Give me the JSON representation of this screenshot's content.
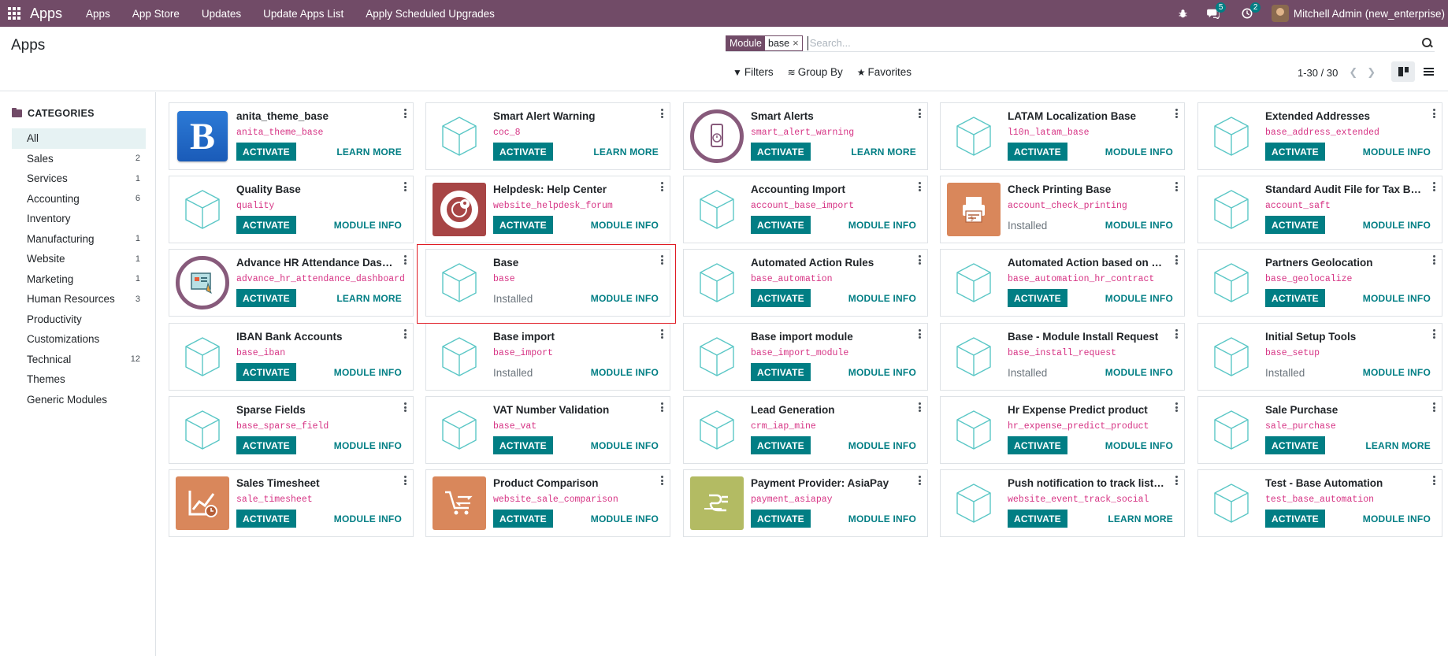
{
  "navbar": {
    "brand": "Apps",
    "menu": [
      "Apps",
      "App Store",
      "Updates",
      "Update Apps List",
      "Apply Scheduled Upgrades"
    ],
    "messages_count": "5",
    "activities_count": "2",
    "user": "Mitchell Admin (new_enterprise)"
  },
  "control_panel": {
    "title": "Apps",
    "search_facet_label": "Module",
    "search_facet_value": "base",
    "search_placeholder": "Search...",
    "filters": "Filters",
    "group_by": "Group By",
    "favorites": "Favorites",
    "pager": "1-30 / 30"
  },
  "sidebar": {
    "header": "CATEGORIES",
    "items": [
      {
        "label": "All",
        "count": ""
      },
      {
        "label": "Sales",
        "count": "2"
      },
      {
        "label": "Services",
        "count": "1"
      },
      {
        "label": "Accounting",
        "count": "6"
      },
      {
        "label": "Inventory",
        "count": ""
      },
      {
        "label": "Manufacturing",
        "count": "1"
      },
      {
        "label": "Website",
        "count": "1"
      },
      {
        "label": "Marketing",
        "count": "1"
      },
      {
        "label": "Human Resources",
        "count": "3"
      },
      {
        "label": "Productivity",
        "count": ""
      },
      {
        "label": "Customizations",
        "count": ""
      },
      {
        "label": "Technical",
        "count": "12"
      },
      {
        "label": "Themes",
        "count": ""
      },
      {
        "label": "Generic Modules",
        "count": ""
      }
    ]
  },
  "labels": {
    "activate": "ACTIVATE",
    "learn_more": "LEARN MORE",
    "module_info": "MODULE INFO",
    "installed": "Installed"
  },
  "apps": [
    {
      "name": "anita_theme_base",
      "tech": "anita_theme_base",
      "icon": "b-letter-icon",
      "installed": false,
      "link": "learn_more"
    },
    {
      "name": "Smart Alert Warning",
      "tech": "coc_8",
      "icon": "cube-icon",
      "installed": false,
      "link": "learn_more"
    },
    {
      "name": "Smart Alerts",
      "tech": "smart_alert_warning",
      "icon": "phone-alert-icon",
      "installed": false,
      "link": "learn_more"
    },
    {
      "name": "LATAM Localization Base",
      "tech": "l10n_latam_base",
      "icon": "cube-icon",
      "installed": false,
      "link": "module_info"
    },
    {
      "name": "Extended Addresses",
      "tech": "base_address_extended",
      "icon": "cube-icon",
      "installed": false,
      "link": "module_info"
    },
    {
      "name": "Quality Base",
      "tech": "quality",
      "icon": "cube-icon",
      "installed": false,
      "link": "module_info"
    },
    {
      "name": "Helpdesk: Help Center",
      "tech": "website_helpdesk_forum",
      "icon": "lifebuoy-icon",
      "installed": false,
      "link": "module_info"
    },
    {
      "name": "Accounting Import",
      "tech": "account_base_import",
      "icon": "cube-icon",
      "installed": false,
      "link": "module_info"
    },
    {
      "name": "Check Printing Base",
      "tech": "account_check_printing",
      "icon": "printer-icon",
      "installed": true,
      "link": "module_info"
    },
    {
      "name": "Standard Audit File for Tax Base module",
      "tech": "account_saft",
      "icon": "cube-icon",
      "installed": false,
      "link": "module_info"
    },
    {
      "name": "Advance HR Attendance Dashboard",
      "tech": "advance_hr_attendance_dashboard",
      "icon": "dashboard-icon",
      "installed": false,
      "link": "learn_more"
    },
    {
      "name": "Base",
      "tech": "base",
      "icon": "cube-icon",
      "installed": true,
      "link": "module_info"
    },
    {
      "name": "Automated Action Rules",
      "tech": "base_automation",
      "icon": "cube-icon",
      "installed": false,
      "link": "module_info"
    },
    {
      "name": "Automated Action based on Employee Contracts",
      "tech": "base_automation_hr_contract",
      "icon": "cube-icon",
      "installed": false,
      "link": "module_info"
    },
    {
      "name": "Partners Geolocation",
      "tech": "base_geolocalize",
      "icon": "cube-icon",
      "installed": false,
      "link": "module_info"
    },
    {
      "name": "IBAN Bank Accounts",
      "tech": "base_iban",
      "icon": "cube-icon",
      "installed": false,
      "link": "module_info"
    },
    {
      "name": "Base import",
      "tech": "base_import",
      "icon": "cube-icon",
      "installed": true,
      "link": "module_info"
    },
    {
      "name": "Base import module",
      "tech": "base_import_module",
      "icon": "cube-icon",
      "installed": false,
      "link": "module_info"
    },
    {
      "name": "Base - Module Install Request",
      "tech": "base_install_request",
      "icon": "cube-icon",
      "installed": true,
      "link": "module_info"
    },
    {
      "name": "Initial Setup Tools",
      "tech": "base_setup",
      "icon": "cube-icon",
      "installed": true,
      "link": "module_info"
    },
    {
      "name": "Sparse Fields",
      "tech": "base_sparse_field",
      "icon": "cube-icon",
      "installed": false,
      "link": "module_info"
    },
    {
      "name": "VAT Number Validation",
      "tech": "base_vat",
      "icon": "cube-icon",
      "installed": false,
      "link": "module_info"
    },
    {
      "name": "Lead Generation",
      "tech": "crm_iap_mine",
      "icon": "cube-icon",
      "installed": false,
      "link": "module_info"
    },
    {
      "name": "Hr Expense Predict product",
      "tech": "hr_expense_predict_product",
      "icon": "cube-icon",
      "installed": false,
      "link": "module_info"
    },
    {
      "name": "Sale Purchase",
      "tech": "sale_purchase",
      "icon": "cube-icon",
      "installed": false,
      "link": "learn_more"
    },
    {
      "name": "Sales Timesheet",
      "tech": "sale_timesheet",
      "icon": "chart-clock-icon",
      "installed": false,
      "link": "module_info"
    },
    {
      "name": "Product Comparison",
      "tech": "website_sale_comparison",
      "icon": "cart-compare-icon",
      "installed": false,
      "link": "module_info"
    },
    {
      "name": "Payment Provider: AsiaPay",
      "tech": "payment_asiapay",
      "icon": "asiapay-icon",
      "installed": false,
      "link": "module_info"
    },
    {
      "name": "Push notification to track listeners",
      "tech": "website_event_track_social",
      "icon": "cube-icon",
      "installed": false,
      "link": "learn_more"
    },
    {
      "name": "Test - Base Automation",
      "tech": "test_base_automation",
      "icon": "cube-icon",
      "installed": false,
      "link": "module_info"
    }
  ]
}
